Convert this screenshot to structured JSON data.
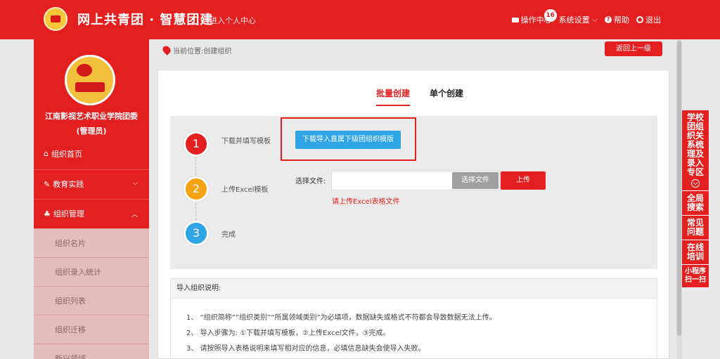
{
  "header": {
    "site_title": "网上共青团 · 智慧团建",
    "personal_center": "进入个人中心",
    "ops_center": "操作中心",
    "ops_badge": "16",
    "settings": "系统设置",
    "help": "帮助",
    "logout": "退出"
  },
  "sidebar": {
    "org_name": "江南影视艺术职业学院团委",
    "org_role": "(管理员)",
    "items": [
      {
        "label": "组织首页"
      },
      {
        "label": "教育实践"
      },
      {
        "label": "组织管理"
      }
    ],
    "subitems": [
      {
        "label": "组织名片"
      },
      {
        "label": "组织录入统计"
      },
      {
        "label": "组织列表"
      },
      {
        "label": "组织迁移"
      },
      {
        "label": "新兴领域"
      }
    ]
  },
  "breadcrumb": {
    "text": "当前位置:创建组织",
    "back": "返回上一级"
  },
  "tabs": {
    "batch": "批量创建",
    "single": "单个创建"
  },
  "steps": [
    {
      "num": "1",
      "label": "下载并填写模板",
      "color": "#e41f1f"
    },
    {
      "num": "2",
      "label": "上传Excel模板",
      "color": "#f6a313"
    },
    {
      "num": "3",
      "label": "完成",
      "color": "#2fa5e6"
    }
  ],
  "download_button": "下载导入直属下级团组织模版",
  "file": {
    "label": "选择文件:",
    "choose": "选择文件",
    "upload": "上传",
    "hint": "请上传Excel表格文件"
  },
  "notes": {
    "title": "导入组织说明:",
    "lines": [
      "1、 “组织简称”“组织类别”“所属领域类别”为必填项，数据缺失或格式不符都会导致数据无法上传。",
      "2、 导入步骤为: ①下载并填写模板，②上传Excel文件，③完成。",
      "3、 请按照导入表格说明来填写相对应的信息，必填信息缺失会使导入失败。"
    ]
  },
  "float_panel": [
    {
      "label": "学校团组织关系梳理及录入专区"
    },
    {
      "label": "全局搜索"
    },
    {
      "label": "常见问题"
    },
    {
      "label": "在线培训"
    },
    {
      "label": "小程序扫一扫"
    }
  ]
}
